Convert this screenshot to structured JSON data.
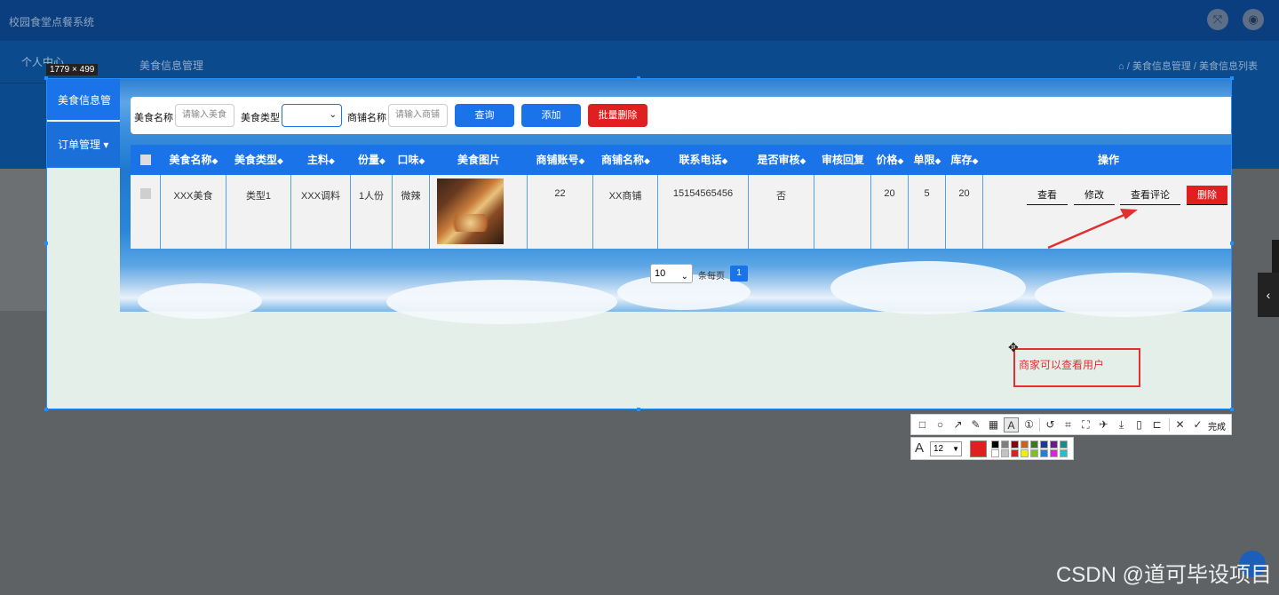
{
  "app": {
    "title": "校园食堂点餐系统",
    "header_icons": [
      "fullscreen-icon",
      "user-icon"
    ]
  },
  "sidebar": {
    "items": [
      {
        "label": "个人中心"
      },
      {
        "label": "美食信息管理"
      },
      {
        "label": "订单管理"
      }
    ]
  },
  "page": {
    "title": "美食信息管理",
    "breadcrumb": "⌂ / 美食信息管理 / 美食信息列表"
  },
  "capture": {
    "size_label": "1779 × 499",
    "accent": "#1e90ff"
  },
  "search": {
    "name_label": "美食名称",
    "name_placeholder": "请输入美食",
    "type_label": "美食类型",
    "shop_label": "商铺名称",
    "shop_placeholder": "请输入商铺",
    "query_button": "查询",
    "add_button": "添加",
    "batch_delete_button": "批量删除"
  },
  "table": {
    "columns": [
      "美食名称",
      "美食类型",
      "主料",
      "份量",
      "口味",
      "美食图片",
      "商铺账号",
      "商铺名称",
      "联系电话",
      "是否审核",
      "审核回复",
      "价格",
      "单限",
      "库存",
      "操作"
    ],
    "rows": [
      {
        "name": "XXX美食",
        "type": "类型1",
        "main": "XXX调料",
        "portion": "1人份",
        "taste": "微辣",
        "shop_account": "22",
        "shop_name": "XX商铺",
        "phone": "15154565456",
        "reviewed": "否",
        "review_reply": "",
        "price": "20",
        "limit": "5",
        "stock": "20",
        "actions": {
          "view": "查看",
          "edit": "修改",
          "view_comments": "查看评论",
          "delete": "删除"
        }
      }
    ]
  },
  "pagination": {
    "page_size": "10",
    "per_page_label": "条每页",
    "current_page": "1"
  },
  "annotation": {
    "text": "商家可以查看用户",
    "color": "#e03030"
  },
  "screenshot_toolbar": {
    "tools": [
      "rectangle-icon",
      "ellipse-icon",
      "arrow-icon",
      "pen-icon",
      "mosaic-icon",
      "text-icon",
      "number-icon",
      "undo-icon",
      "crop-icon",
      "ocr-icon",
      "pin-icon",
      "download-icon",
      "save-icon",
      "bookmark-icon",
      "close-icon",
      "check-icon"
    ],
    "done_label": "完成",
    "font_size": "12",
    "current_color": "#e02020",
    "palette": [
      "#000000",
      "#7f7f7f",
      "#880015",
      "#d06020",
      "#3a7a20",
      "#1a3a9a",
      "#6a1a8a",
      "#1a8a8a",
      "#ffffff",
      "#c3c3c3",
      "#e02020",
      "#f0f000",
      "#80c020",
      "#2080e0",
      "#e020e0",
      "#20c0d0"
    ]
  },
  "watermark": "CSDN @道可毕设项目"
}
